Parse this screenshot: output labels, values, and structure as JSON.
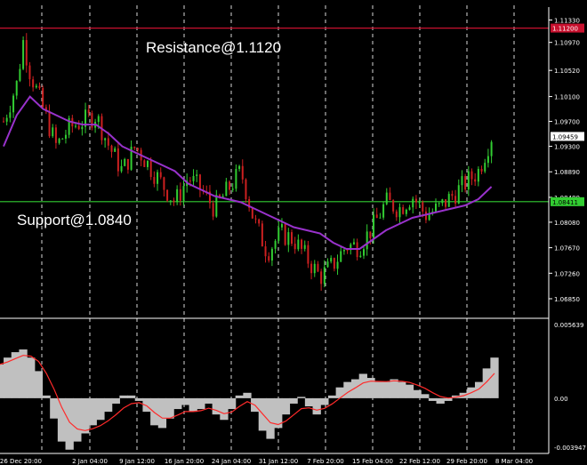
{
  "chart_data": {
    "type": "candlestick",
    "colors": {
      "background": "#000000",
      "bull_candle": "#32cd32",
      "bear_candle": "#cc2020",
      "moving_average": "#9932cc",
      "resistance_line": "#c8102e",
      "support_line": "#32cd32",
      "grid": "#ffffff",
      "macd_histogram": "#c0c0c0",
      "macd_signal": "#ff2a2a",
      "current_price_tag": "#ffffff"
    },
    "annotations": {
      "resistance": "Resistance@1.1120",
      "support": "Support@1.0840"
    },
    "price_axis": {
      "ticks": [
        "1.11330",
        "1.10970",
        "1.10520",
        "1.10100",
        "1.09700",
        "1.09300",
        "1.08890",
        "1.08480",
        "1.08080",
        "1.07670",
        "1.07260",
        "1.06850"
      ],
      "ylim": [
        1.0665,
        1.1148
      ]
    },
    "levels": {
      "resistance": {
        "value": 1.112,
        "tag": "1.11200"
      },
      "support": {
        "value": 1.0841,
        "tag": "1.08411"
      },
      "current": {
        "value": 1.09459,
        "tag": "1.09459"
      }
    },
    "x_axis": {
      "ticks": [
        "26 Dec 20:00",
        "2 Jan 04:00",
        "9 Jan 12:00",
        "16 Jan 20:00",
        "24 Jan 04:00",
        "31 Jan 12:00",
        "7 Feb 20:00",
        "15 Feb 04:00",
        "22 Feb 12:00",
        "29 Feb 20:00",
        "8 Mar 04:00"
      ]
    },
    "indicator_axis": {
      "ticks": [
        "0.005639",
        "0.00",
        "-0.003947"
      ],
      "ylim": [
        -0.003947,
        0.005639
      ]
    },
    "close_path": [
      [
        0,
        1.097
      ],
      [
        2,
        1.103
      ],
      [
        3,
        1.11
      ],
      [
        4,
        1.105
      ],
      [
        6,
        1.099
      ],
      [
        8,
        1.093
      ],
      [
        10,
        1.096
      ],
      [
        12,
        1.097
      ],
      [
        14,
        1.098
      ],
      [
        16,
        1.093
      ],
      [
        18,
        1.089
      ],
      [
        20,
        1.093
      ],
      [
        22,
        1.09
      ],
      [
        24,
        1.087
      ],
      [
        26,
        1.084
      ],
      [
        28,
        1.088
      ],
      [
        30,
        1.086
      ],
      [
        32,
        1.083
      ],
      [
        34,
        1.086
      ],
      [
        36,
        1.089
      ],
      [
        38,
        1.081
      ],
      [
        40,
        1.076
      ],
      [
        42,
        1.079
      ],
      [
        44,
        1.078
      ],
      [
        46,
        1.075
      ],
      [
        48,
        1.072
      ],
      [
        50,
        1.074
      ],
      [
        52,
        1.077
      ],
      [
        54,
        1.077
      ],
      [
        56,
        1.08
      ],
      [
        58,
        1.084
      ],
      [
        60,
        1.083
      ],
      [
        62,
        1.085
      ],
      [
        64,
        1.082
      ],
      [
        66,
        1.083
      ],
      [
        68,
        1.085
      ],
      [
        70,
        1.087
      ],
      [
        72,
        1.089
      ],
      [
        74,
        1.0946
      ]
    ],
    "moving_average": [
      [
        0,
        1.093
      ],
      [
        2,
        1.098
      ],
      [
        4,
        1.101
      ],
      [
        6,
        1.099
      ],
      [
        8,
        1.098
      ],
      [
        10,
        1.097
      ],
      [
        12,
        1.0965
      ],
      [
        14,
        1.0965
      ],
      [
        16,
        1.095
      ],
      [
        18,
        1.093
      ],
      [
        20,
        1.092
      ],
      [
        22,
        1.091
      ],
      [
        24,
        1.09
      ],
      [
        26,
        1.089
      ],
      [
        28,
        1.087
      ],
      [
        30,
        1.086
      ],
      [
        32,
        1.085
      ],
      [
        34,
        1.0845
      ],
      [
        36,
        1.084
      ],
      [
        38,
        1.083
      ],
      [
        40,
        1.082
      ],
      [
        42,
        1.081
      ],
      [
        44,
        1.08
      ],
      [
        46,
        1.0795
      ],
      [
        48,
        1.079
      ],
      [
        50,
        1.0775
      ],
      [
        52,
        1.0765
      ],
      [
        54,
        1.0765
      ],
      [
        56,
        1.078
      ],
      [
        58,
        1.0795
      ],
      [
        60,
        1.0805
      ],
      [
        62,
        1.0815
      ],
      [
        64,
        1.082
      ],
      [
        66,
        1.0825
      ],
      [
        68,
        1.083
      ],
      [
        70,
        1.0835
      ],
      [
        72,
        1.0845
      ],
      [
        74,
        1.0865
      ]
    ],
    "oscillator": [
      0.0025,
      0.003,
      0.0034,
      0.0036,
      0.003,
      0.002,
      0.0002,
      -0.0015,
      -0.0032,
      -0.0038,
      -0.0032,
      -0.0026,
      -0.002,
      -0.0016,
      -0.001,
      -0.0004,
      0.0002,
      0.0002,
      -0.0002,
      -0.001,
      -0.002,
      -0.0022,
      -0.0015,
      -0.0008,
      -0.0005,
      -0.001,
      -0.0008,
      -0.0004,
      -0.0012,
      -0.0016,
      -0.0008,
      0.0002,
      0.0004,
      -0.001,
      -0.0024,
      -0.003,
      -0.0022,
      -0.0012,
      -0.0004,
      0.0001,
      -0.0006,
      -0.0012,
      -0.0005,
      0.0002,
      0.0008,
      0.0012,
      0.0014,
      0.0018,
      0.0015,
      0.0012,
      0.0012,
      0.0014,
      0.0012,
      0.001,
      0.0006,
      0.0003,
      -0.0002,
      -0.0004,
      -0.0002,
      0.0002,
      0.0004,
      0.0008,
      0.0012,
      0.0022,
      0.003
    ]
  }
}
